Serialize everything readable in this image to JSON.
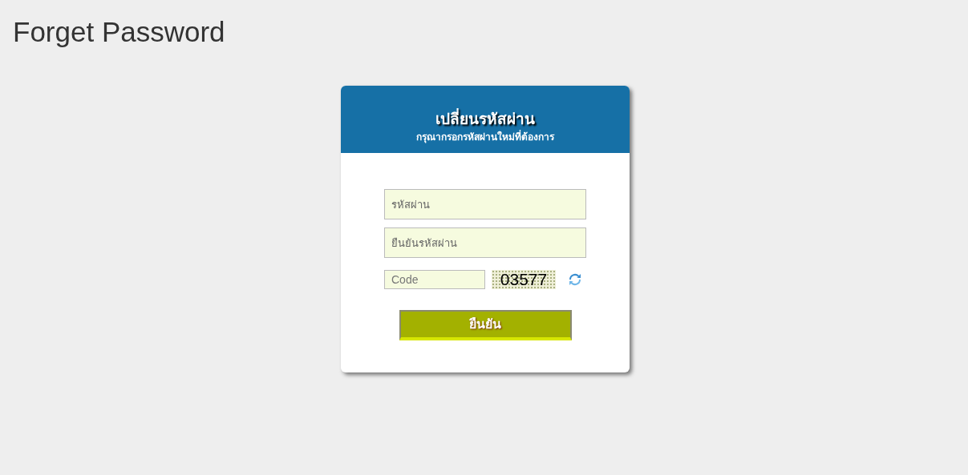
{
  "page_title": "Forget Password",
  "card": {
    "title": "เปลี่ยนรหัสผ่าน",
    "subtitle": "กรุณากรอกรหัสผ่านใหม่ที่ต้องการ"
  },
  "fields": [
    {
      "placeholder": "รหัสผ่าน"
    },
    {
      "placeholder": "ยืนยันรหัสผ่าน"
    }
  ],
  "captcha": {
    "placeholder": "Code",
    "code": "03577"
  },
  "submit": "ยืนยัน"
}
